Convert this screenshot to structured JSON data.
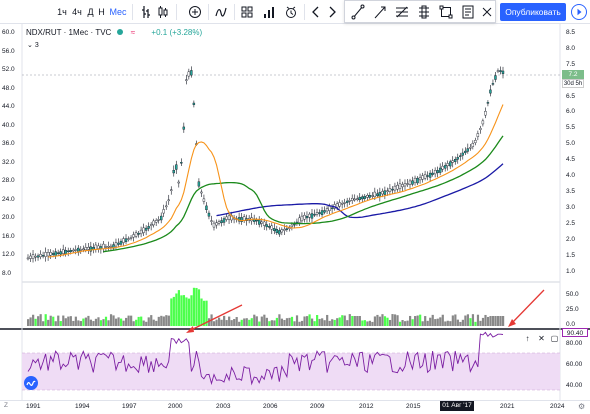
{
  "toolbar": {
    "intervals": [
      "1ч",
      "4ч",
      "Д",
      "Н",
      "Мес"
    ],
    "active_interval": "Мес",
    "publish_label": "Опубликовать"
  },
  "legend": {
    "symbol": "NDX/RUT",
    "interval": "1Мес",
    "source": "TVC",
    "change": "+0.1 (+3.28%)",
    "indicators_count": "3"
  },
  "price_axis_left": [
    "60.0",
    "56.0",
    "52.0",
    "48.0",
    "44.0",
    "40.0",
    "36.0",
    "32.0",
    "28.0",
    "24.0",
    "20.0",
    "16.0",
    "12.0",
    "8.0"
  ],
  "price_axis_right": [
    "8.5",
    "8.0",
    "7.5",
    "7.0",
    "6.5",
    "6.0",
    "5.5",
    "5.0",
    "4.5",
    "4.0",
    "3.5",
    "3.0",
    "2.5",
    "2.0",
    "1.5",
    "1.0"
  ],
  "last_price": "7.2",
  "countdown": "30d 5h",
  "volume_axis": [
    "50.0",
    "25.0",
    "0.0"
  ],
  "rsi_axis": [
    "80.00",
    "60.00",
    "40.00"
  ],
  "rsi_value": "90.40",
  "years": [
    "1991",
    "1994",
    "1997",
    "2000",
    "2003",
    "2006",
    "2009",
    "2012",
    "2015",
    "2018",
    "2021",
    "2024"
  ],
  "date_marker": "01 Авг '17",
  "corner_label": "Z",
  "colors": {
    "up": "#26a69a",
    "ma_fast": "#f7931a",
    "ma_mid": "#1b8a1b",
    "ma_slow": "#1a1aa6",
    "rsi_line": "#7b1fa2",
    "rsi_band": "#efdcf5",
    "volume_hi": "#4cff4c",
    "volume_lo": "#888888",
    "arrow": "#e53935",
    "accent": "#2962ff"
  },
  "icons": [
    "bar-style-icon",
    "candle-style-icon",
    "compare-icon",
    "indicators-icon",
    "templates-icon",
    "alert-icon",
    "replay-icon",
    "undo-icon",
    "redo-icon",
    "trendline-icon",
    "arrow-tool-icon",
    "fib-icon",
    "brush-icon",
    "rectangle-icon",
    "measure-icon",
    "close-icon",
    "play-icon"
  ]
}
